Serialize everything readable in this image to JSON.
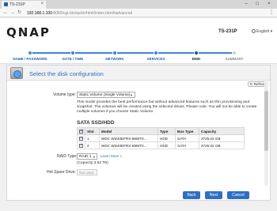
{
  "browser": {
    "tab_title": "TS-231P",
    "address_host": "192.168.1.100",
    "address_path": ":8080/cgi-bin/quick/html/index.html#advanced"
  },
  "header": {
    "logo": "QNAP",
    "model": "TS-231P",
    "language": "English"
  },
  "steps": [
    {
      "label": "NAME / PASSWORD"
    },
    {
      "label": "DATE / TIME"
    },
    {
      "label": "NETWORK"
    },
    {
      "label": "SERVICES"
    },
    {
      "label": "DISK"
    },
    {
      "label": "SUMMARY"
    }
  ],
  "panel": {
    "title": "Select the disk configuration",
    "refresh_label": "Refresh",
    "volume_type_label": "Volume type:",
    "volume_type_value": "Static Volume (Single Volume)",
    "description": "This model provides the best performance but without advanced features such as thin provisioning and snapshot. The volumes will be created using the selected drives. Please note: You will not be able to create multiple volumes if you choose Static Volume.",
    "sata_title": "SATA SSD/HDD",
    "table": {
      "headers": [
        "",
        "Slot",
        "Model",
        "Type",
        "Bus Type",
        "Capacity"
      ],
      "rows": [
        {
          "slot": "1",
          "model": "WDC WD40EFRX-68WT0...",
          "type": "HDD",
          "bus": "SATA",
          "capacity": "3726.02 GB"
        },
        {
          "slot": "2",
          "model": "WDC WD40EFRX-68WT0...",
          "type": "HDD",
          "bus": "SATA",
          "capacity": "3726.02 GB"
        }
      ]
    },
    "raid_label": "RAID Type:",
    "raid_value": "RAID 1",
    "learn_more": "Learn More »",
    "capacity": "(Capacity:3.62 TB)",
    "hot_spare_label": "Hot Spare Drive:",
    "hot_spare_value": "Not used"
  },
  "buttons": {
    "back": "Back",
    "next": "Next",
    "cancel": "Cancel"
  }
}
